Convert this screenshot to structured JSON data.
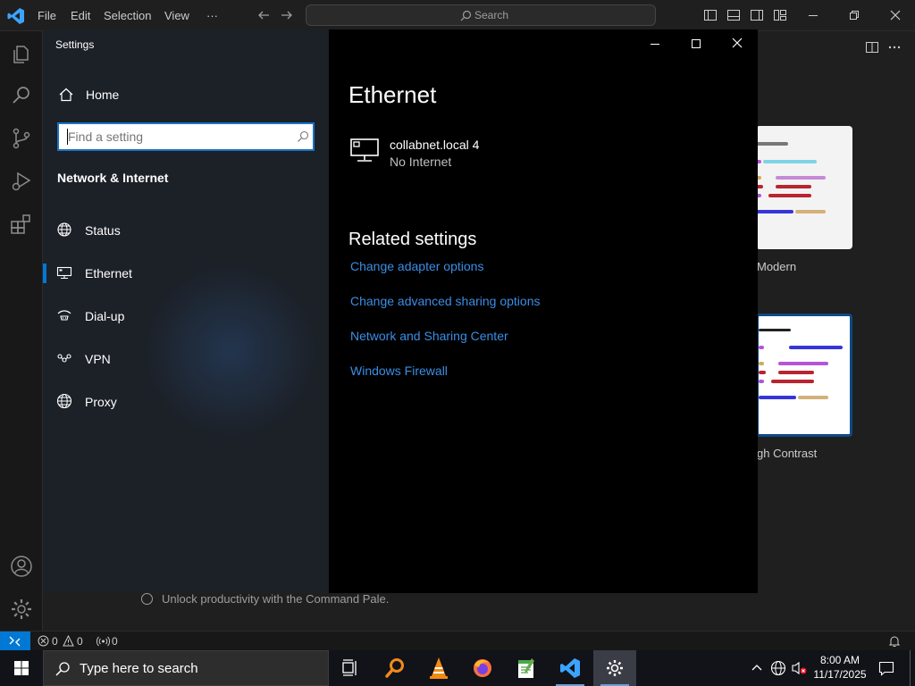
{
  "vscode": {
    "menu": [
      "File",
      "Edit",
      "Selection",
      "View",
      "···"
    ],
    "search_label": "Search",
    "walkthrough_item": "Unlock productivity with the Command Pale.",
    "themes": [
      {
        "label": "Modern"
      },
      {
        "label": "gh Contrast"
      }
    ],
    "status": {
      "errors": "0",
      "warnings": "0",
      "ports": "0"
    }
  },
  "settings": {
    "window_title": "Settings",
    "home_label": "Home",
    "search_placeholder": "Find a setting",
    "section_title": "Network & Internet",
    "nav_items": [
      {
        "label": "Status",
        "icon": "globe-icon"
      },
      {
        "label": "Ethernet",
        "icon": "ethernet-icon",
        "selected": true
      },
      {
        "label": "Dial-up",
        "icon": "dialup-icon"
      },
      {
        "label": "VPN",
        "icon": "vpn-icon"
      },
      {
        "label": "Proxy",
        "icon": "globe-icon"
      }
    ],
    "page_title": "Ethernet",
    "network": {
      "name": "collabnet.local 4",
      "status": "No Internet"
    },
    "related_title": "Related settings",
    "related_links": [
      "Change adapter options",
      "Change advanced sharing options",
      "Network and Sharing Center",
      "Windows Firewall"
    ]
  },
  "taskbar": {
    "search_placeholder": "Type here to search",
    "time": "8:00 AM",
    "date": "11/17/2025"
  },
  "colors": {
    "accent": "#0078d4",
    "link": "#3a8ee6",
    "settings_nav_bg": "#1c2027",
    "settings_content_bg": "#000000"
  }
}
